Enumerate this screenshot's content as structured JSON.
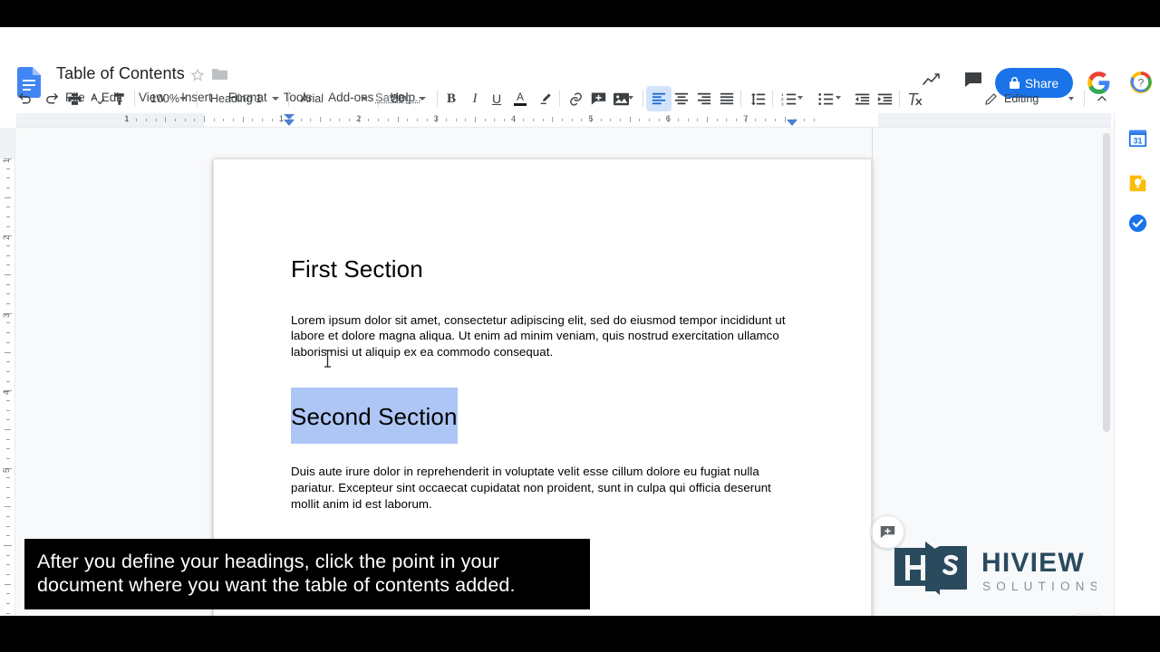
{
  "app": {
    "name": "Google Docs",
    "doc_icon": "google-docs-icon"
  },
  "header": {
    "title": "Table of Contents",
    "star_icon": "star-outline-icon",
    "folder_icon": "folder-icon",
    "menus": [
      "File",
      "Edit",
      "View",
      "Insert",
      "Format",
      "Tools",
      "Add-ons",
      "Help"
    ],
    "save_status": "Saving...",
    "activity_icon": "activity-trend-icon",
    "comments_icon": "comment-bubble-icon",
    "share_label": "Share",
    "share_lock_icon": "lock-icon",
    "share_color": "#1a73e8",
    "avatar_icon": "google-g-avatar",
    "help_icon": "help-question-icon"
  },
  "toolbar": {
    "undo": "undo-icon",
    "redo": "redo-icon",
    "print": "print-icon",
    "spellcheck": "spellcheck-icon",
    "paint_format": "paint-format-icon",
    "zoom_value": "100%",
    "style_value": "Heading 1",
    "font_value": "Arial",
    "size_value": "20",
    "bold": "B",
    "italic": "I",
    "underline": "U",
    "text_color": "A",
    "highlight": "highlighter-icon",
    "link": "link-icon",
    "add_comment": "add-comment-icon",
    "insert_image": "insert-image-icon",
    "align_left": "align-left-icon",
    "align_center": "align-center-icon",
    "align_right": "align-right-icon",
    "align_justify": "align-justify-icon",
    "line_spacing": "line-spacing-icon",
    "numbered_list": "numbered-list-icon",
    "bulleted_list": "bulleted-list-icon",
    "decrease_indent": "decrease-indent-icon",
    "increase_indent": "increase-indent-icon",
    "clear_formatting": "clear-formatting-icon",
    "mode_label": "Editing",
    "mode_icon": "pencil-icon",
    "collapse_icon": "chevron-up-icon",
    "active_alignment": "align_left"
  },
  "ruler": {
    "horizontal_numbers": [
      "1",
      "1",
      "2",
      "3",
      "4",
      "5",
      "6",
      "7"
    ],
    "vertical_numbers": [
      "1",
      "2",
      "3",
      "4",
      "5"
    ],
    "left_indent_marker": "indent-marker-left",
    "right_indent_marker": "indent-marker-right"
  },
  "document": {
    "heading1": "First Section",
    "paragraph1": "Lorem ipsum dolor sit amet, consectetur adipiscing elit, sed do eiusmod tempor incididunt ut labore et dolore magna aliqua. Ut enim ad minim veniam, quis nostrud exercitation ullamco laboris nisi ut aliquip ex ea commodo consequat.",
    "heading2": "Second Section",
    "heading2_selected": true,
    "selection_color": "#aec6f5",
    "paragraph2": "Duis aute irure dolor in reprehenderit in voluptate velit esse cillum dolore eu fugiat nulla pariatur. Excepteur sint occaecat cupidatat non proident, sunt in culpa qui officia deserunt mollit anim id est laborum.",
    "comment_fab_icon": "add-comment-fab-icon",
    "text_cursor": "i-beam-cursor"
  },
  "side_panel": {
    "items": [
      {
        "name": "google-calendar",
        "icon": "calendar-31-icon",
        "color": "#1a73e8"
      },
      {
        "name": "google-keep",
        "icon": "keep-bulb-icon",
        "color": "#fbbc04"
      },
      {
        "name": "google-tasks",
        "icon": "tasks-check-icon",
        "color": "#1a73e8"
      }
    ],
    "expand_icon": "chevron-right-icon",
    "explore_icon": "explore-star-icon"
  },
  "logo": {
    "monogram": "HS",
    "name": "HIVIEW",
    "tagline": "SOLUTIONS",
    "primary_color": "#2a4a5e",
    "secondary_color": "#8a8f94"
  },
  "caption": {
    "text": "After you define your headings, click the point in your document where you want the table of contents added."
  }
}
